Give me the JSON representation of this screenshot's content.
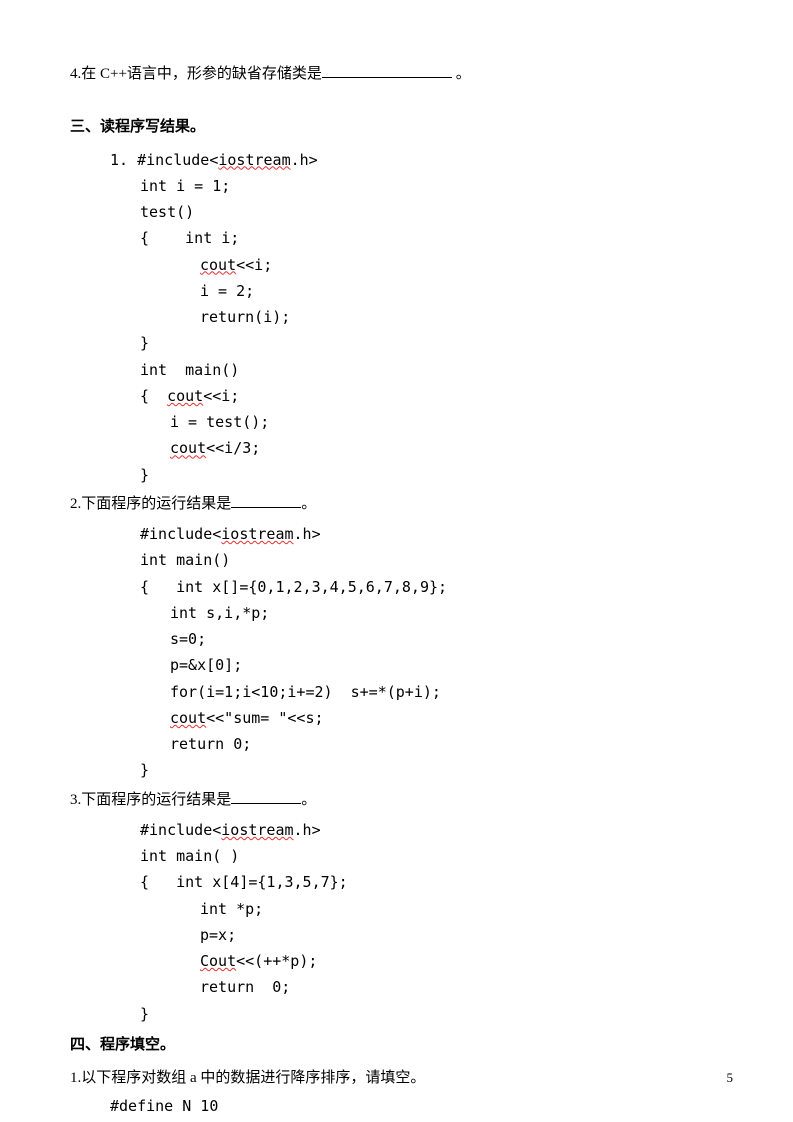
{
  "q4": {
    "prefix": "4.在 C++语言中，形参的缺省存储类是",
    "suffix": " 。"
  },
  "section3": {
    "title": "三、读程序写结果。",
    "prog1": {
      "line1_pre": "1. #include<",
      "line1_red": "iostream",
      "line1_post": ".h>",
      "line2": "int i = 1;",
      "line3": "test()",
      "line4": "{    int i;",
      "line5_red": "cout",
      "line5_post": "<<i;",
      "line6": "i = 2;",
      "line7": "return(i);",
      "line8": "}",
      "line9": "int  main()",
      "line10_pre": "{  ",
      "line10_red": "cout",
      "line10_post": "<<i;",
      "line11": "i = test();",
      "line12_red": "cout",
      "line12_post": "<<i/3;",
      "line13": "}"
    },
    "prog2": {
      "question": "2.下面程序的运行结果是",
      "question_suffix": "。",
      "line1_pre": "#include<",
      "line1_red": "iostream",
      "line1_post": ".h>",
      "line2": "int main()",
      "line3": "{   int x[]={0,1,2,3,4,5,6,7,8,9};",
      "line4": "int s,i,*p;",
      "line5": "s=0;",
      "line6": "p=&x[0];",
      "line7": "for(i=1;i<10;i+=2)  s+=*(p+i);",
      "line8_red": "cout",
      "line8_post": "<<\"sum= \"<<s;",
      "line9": "return 0;",
      "line10": "}"
    },
    "prog3": {
      "question": "3.下面程序的运行结果是",
      "question_suffix": "。",
      "line1_pre": "#include<",
      "line1_red": "iostream",
      "line1_post": ".h>",
      "line2": "int main( )",
      "line3": "{   int x[4]={1,3,5,7};",
      "line4": "int *p;",
      "line5": "p=x;",
      "line6_red": "Cout",
      "line6_post": "<<(++*p);",
      "line7": "return  0;",
      "line8": "}"
    }
  },
  "section4": {
    "title": "四、程序填空。",
    "q1": "1.以下程序对数组 a 中的数据进行降序排序，请填空。",
    "code1": "#define N 10"
  },
  "page_number": "5"
}
